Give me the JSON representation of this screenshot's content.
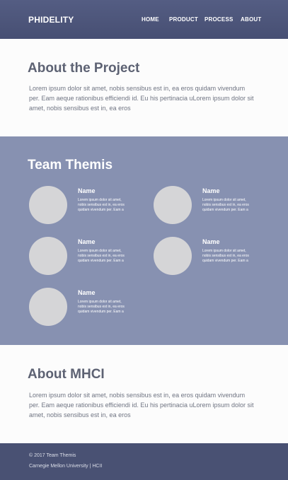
{
  "header": {
    "brand": "PHIDELITY",
    "nav": [
      "HOME",
      "PRODUCT",
      "PROCESS",
      "ABOUT"
    ]
  },
  "project": {
    "title": "About the Project",
    "body": "Lorem ipsum dolor sit amet, nobis sensibus est in, ea eros quidam vivendum per. Eam aeque rationibus efficiendi id. Eu his pertinacia uLorem ipsum dolor sit amet, nobis sensibus est in, ea eros"
  },
  "team": {
    "title": "Team Themis",
    "members": [
      {
        "name": "Name",
        "bio": "Lorem ipsum dolor sit amet, nobis sensibus est in, ea eros quidam vivendum per. Eam a"
      },
      {
        "name": "Name",
        "bio": "Lorem ipsum dolor sit amet, nobis sensibus est in, ea eros quidam vivendum per. Eam a"
      },
      {
        "name": "Name",
        "bio": "Lorem ipsum dolor sit amet, nobis sensibus est in, ea eros quidam vivendum per. Eam a"
      },
      {
        "name": "Name",
        "bio": "Lorem ipsum dolor sit amet, nobis sensibus est in, ea eros quidam vivendum per. Eam a"
      },
      {
        "name": "Name",
        "bio": "Lorem ipsum dolor sit amet, nobis sensibus est in, ea eros quidam vivendum per. Eam a"
      }
    ]
  },
  "mhci": {
    "title": "About MHCI",
    "body": "Lorem ipsum dolor sit amet, nobis sensibus est in, ea eros quidam vivendum per. Eam aeque rationibus efficiendi id. Eu his pertinacia uLorem ipsum dolor sit amet, nobis sensibus est in, ea eros"
  },
  "footer": {
    "copyright": "© 2017 Team Themis",
    "affiliation": "Carnegie Mellon University | HCII"
  },
  "colors": {
    "header_bg": "#4d5579",
    "team_bg": "#8791b1",
    "footer_bg": "#495173",
    "heading": "#5d6273",
    "avatar": "#d5d5d7"
  }
}
